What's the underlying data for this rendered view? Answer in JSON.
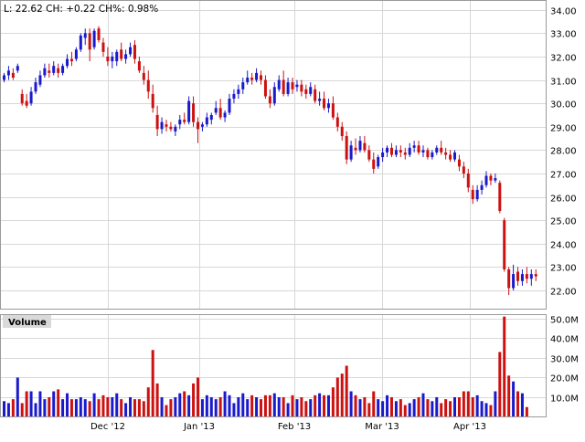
{
  "header": {
    "quote": "L: 22.62 CH: +0.22 CH%: 0.98%"
  },
  "colors": {
    "up": "#1a1acc",
    "down": "#cc1111",
    "grid": "#d8d8d8",
    "frame": "#9a9a9a",
    "panel_label_bg": "#d9d9d9",
    "text": "#000000"
  },
  "chart_data": [
    {
      "type": "candlestick",
      "title": "",
      "xlabel": "",
      "ylabel": "",
      "ylim": [
        21.2,
        34.4
      ],
      "y_ticks": [
        "22.00",
        "23.00",
        "24.00",
        "25.00",
        "26.00",
        "27.00",
        "28.00",
        "29.00",
        "30.00",
        "31.00",
        "32.00",
        "33.00",
        "34.00"
      ],
      "x_ticks": [
        "Dec '12",
        "Jan '13",
        "Feb '13",
        "Mar '13",
        "Apr '13"
      ],
      "grid": true,
      "series": [
        {
          "values": [
            [
              31.0,
              31.3,
              30.9,
              31.2
            ],
            [
              31.2,
              31.6,
              31.0,
              31.4
            ],
            [
              31.3,
              31.5,
              31.0,
              31.1
            ],
            [
              31.4,
              31.7,
              31.3,
              31.6
            ],
            [
              30.4,
              30.6,
              29.9,
              30.0
            ],
            [
              30.1,
              30.4,
              29.8,
              29.9
            ],
            [
              30.0,
              30.7,
              29.9,
              30.5
            ],
            [
              30.5,
              31.1,
              30.4,
              30.9
            ],
            [
              30.8,
              31.4,
              30.7,
              31.2
            ],
            [
              31.2,
              31.7,
              31.1,
              31.5
            ],
            [
              31.4,
              31.7,
              31.1,
              31.3
            ],
            [
              31.3,
              31.8,
              31.2,
              31.6
            ],
            [
              31.5,
              31.7,
              31.1,
              31.3
            ],
            [
              31.3,
              31.7,
              31.2,
              31.6
            ],
            [
              31.6,
              32.1,
              31.5,
              31.9
            ],
            [
              31.9,
              32.2,
              31.6,
              31.8
            ],
            [
              31.9,
              32.4,
              31.8,
              32.3
            ],
            [
              32.3,
              33.0,
              32.2,
              32.9
            ],
            [
              32.8,
              33.2,
              32.5,
              33.0
            ],
            [
              33.0,
              33.2,
              31.8,
              32.3
            ],
            [
              32.4,
              33.2,
              32.3,
              33.1
            ],
            [
              33.2,
              33.3,
              32.6,
              32.7
            ],
            [
              32.6,
              32.8,
              32.0,
              32.2
            ],
            [
              32.0,
              32.4,
              31.6,
              31.8
            ],
            [
              31.8,
              32.2,
              31.5,
              32.0
            ],
            [
              31.8,
              32.3,
              31.6,
              32.2
            ],
            [
              32.3,
              32.6,
              31.8,
              31.9
            ],
            [
              31.9,
              32.3,
              31.7,
              32.1
            ],
            [
              32.1,
              32.6,
              32.0,
              32.4
            ],
            [
              32.5,
              32.7,
              31.7,
              31.9
            ],
            [
              31.8,
              32.0,
              31.3,
              31.4
            ],
            [
              31.3,
              31.6,
              30.8,
              31.0
            ],
            [
              31.0,
              31.4,
              30.2,
              30.5
            ],
            [
              30.4,
              30.8,
              29.6,
              29.8
            ],
            [
              29.5,
              29.9,
              28.6,
              28.9
            ],
            [
              28.9,
              29.4,
              28.7,
              29.2
            ],
            [
              29.1,
              29.3,
              28.8,
              29.0
            ],
            [
              29.0,
              29.2,
              28.8,
              28.9
            ],
            [
              28.8,
              29.1,
              28.6,
              29.0
            ],
            [
              29.1,
              29.5,
              28.9,
              29.3
            ],
            [
              29.3,
              29.6,
              29.1,
              29.2
            ],
            [
              29.2,
              30.3,
              29.1,
              30.1
            ],
            [
              30.0,
              30.3,
              29.0,
              29.2
            ],
            [
              29.2,
              29.4,
              28.3,
              28.9
            ],
            [
              29.0,
              29.2,
              28.8,
              29.1
            ],
            [
              29.1,
              29.6,
              29.0,
              29.4
            ],
            [
              29.3,
              29.6,
              29.1,
              29.5
            ],
            [
              29.6,
              30.1,
              29.5,
              29.8
            ],
            [
              29.8,
              30.2,
              29.3,
              29.4
            ],
            [
              29.4,
              29.7,
              29.2,
              29.6
            ],
            [
              29.6,
              30.4,
              29.5,
              30.2
            ],
            [
              30.2,
              30.6,
              30.0,
              30.4
            ],
            [
              30.4,
              30.8,
              30.2,
              30.6
            ],
            [
              30.6,
              31.1,
              30.4,
              30.9
            ],
            [
              30.9,
              31.4,
              30.8,
              31.1
            ],
            [
              31.1,
              31.3,
              30.8,
              31.0
            ],
            [
              31.0,
              31.5,
              30.9,
              31.3
            ],
            [
              31.2,
              31.4,
              30.8,
              31.0
            ],
            [
              31.0,
              31.2,
              30.2,
              30.3
            ],
            [
              30.3,
              30.6,
              29.8,
              30.0
            ],
            [
              30.0,
              30.9,
              29.9,
              30.7
            ],
            [
              30.6,
              31.2,
              30.5,
              31.0
            ],
            [
              31.0,
              31.4,
              30.3,
              30.4
            ],
            [
              30.4,
              31.1,
              30.3,
              30.9
            ],
            [
              30.9,
              31.1,
              30.4,
              30.6
            ],
            [
              30.7,
              31.0,
              30.5,
              30.8
            ],
            [
              30.8,
              31.0,
              30.3,
              30.5
            ],
            [
              30.6,
              30.8,
              30.2,
              30.4
            ],
            [
              30.4,
              30.9,
              30.3,
              30.7
            ],
            [
              30.6,
              30.8,
              30.0,
              30.1
            ],
            [
              30.1,
              30.5,
              29.9,
              30.2
            ],
            [
              30.2,
              30.5,
              29.7,
              29.8
            ],
            [
              29.8,
              30.2,
              29.6,
              30.0
            ],
            [
              30.0,
              30.3,
              29.3,
              29.4
            ],
            [
              29.4,
              29.6,
              28.8,
              29.0
            ],
            [
              29.0,
              29.2,
              28.4,
              28.6
            ],
            [
              28.6,
              28.8,
              27.4,
              27.6
            ],
            [
              27.6,
              28.4,
              27.5,
              28.2
            ],
            [
              28.1,
              28.5,
              27.8,
              28.0
            ],
            [
              28.0,
              28.6,
              27.9,
              28.4
            ],
            [
              28.3,
              28.6,
              27.9,
              28.0
            ],
            [
              28.0,
              28.2,
              27.5,
              27.6
            ],
            [
              27.6,
              27.9,
              27.0,
              27.2
            ],
            [
              27.3,
              27.8,
              27.2,
              27.7
            ],
            [
              27.7,
              28.1,
              27.5,
              27.9
            ],
            [
              27.9,
              28.2,
              27.7,
              28.1
            ],
            [
              28.1,
              28.3,
              27.7,
              27.8
            ],
            [
              27.8,
              28.2,
              27.7,
              28.0
            ],
            [
              28.0,
              28.2,
              27.7,
              27.9
            ],
            [
              27.9,
              28.1,
              27.6,
              27.8
            ],
            [
              27.8,
              28.3,
              27.7,
              28.1
            ],
            [
              28.1,
              28.4,
              27.9,
              28.2
            ],
            [
              28.2,
              28.4,
              27.8,
              27.9
            ],
            [
              27.9,
              28.2,
              27.7,
              28.0
            ],
            [
              28.0,
              28.1,
              27.6,
              27.7
            ],
            [
              27.7,
              28.0,
              27.6,
              27.9
            ],
            [
              27.9,
              28.2,
              27.8,
              28.1
            ],
            [
              28.1,
              28.4,
              27.8,
              27.9
            ],
            [
              27.9,
              28.1,
              27.6,
              27.8
            ],
            [
              27.8,
              28.0,
              27.5,
              27.6
            ],
            [
              27.6,
              28.0,
              27.5,
              27.9
            ],
            [
              27.6,
              27.8,
              27.1,
              27.3
            ],
            [
              27.3,
              27.5,
              26.8,
              27.0
            ],
            [
              27.0,
              27.2,
              26.2,
              26.4
            ],
            [
              26.3,
              26.5,
              25.7,
              25.9
            ],
            [
              25.9,
              26.5,
              25.8,
              26.3
            ],
            [
              26.3,
              26.7,
              26.1,
              26.5
            ],
            [
              26.5,
              27.1,
              26.4,
              26.9
            ],
            [
              26.9,
              27.0,
              26.5,
              26.7
            ],
            [
              26.7,
              27.0,
              26.6,
              26.8
            ],
            [
              26.6,
              26.7,
              25.3,
              25.4
            ],
            [
              25.0,
              25.1,
              22.8,
              22.9
            ],
            [
              22.9,
              23.0,
              21.8,
              22.1
            ],
            [
              22.1,
              23.1,
              22.0,
              22.7
            ],
            [
              22.8,
              23.0,
              22.2,
              22.4
            ],
            [
              22.4,
              22.9,
              22.2,
              22.7
            ],
            [
              22.7,
              23.0,
              22.3,
              22.5
            ],
            [
              22.5,
              22.9,
              22.2,
              22.7
            ],
            [
              22.7,
              22.9,
              22.4,
              22.6
            ]
          ]
        }
      ]
    },
    {
      "type": "bar",
      "title": "Volume",
      "xlabel": "",
      "ylabel": "",
      "ylim": [
        0,
        52
      ],
      "y_ticks": [
        "10.0M",
        "20.0M",
        "30.0M",
        "40.0M",
        "50.0M"
      ],
      "x_ticks": [
        "Dec '12",
        "Jan '13",
        "Feb '13",
        "Mar '13",
        "Apr '13"
      ],
      "grid": true,
      "series": [
        {
          "values": [
            8,
            7,
            9,
            20,
            7,
            13,
            13,
            7,
            13,
            9,
            10,
            13,
            14,
            9,
            12,
            9,
            9,
            10,
            9,
            8,
            12,
            9,
            11,
            10,
            10,
            12,
            9,
            7,
            10,
            9,
            9,
            8,
            15,
            34,
            17,
            10,
            6,
            9,
            10,
            12,
            13,
            11,
            17,
            20,
            9,
            11,
            10,
            9,
            10,
            13,
            11,
            7,
            10,
            12,
            9,
            11,
            10,
            9,
            11,
            11,
            12,
            10,
            10,
            7,
            11,
            9,
            10,
            8,
            9,
            11,
            12,
            11,
            11,
            15,
            20,
            22,
            26,
            13,
            11,
            9,
            10,
            7,
            13,
            9,
            8,
            11,
            10,
            8,
            9,
            6,
            7,
            9,
            10,
            12,
            9,
            8,
            10,
            7,
            9,
            8,
            10,
            10,
            13,
            13,
            10,
            11,
            8,
            7,
            6,
            13,
            33,
            51,
            21,
            18,
            13,
            12,
            5
          ]
        }
      ]
    }
  ]
}
